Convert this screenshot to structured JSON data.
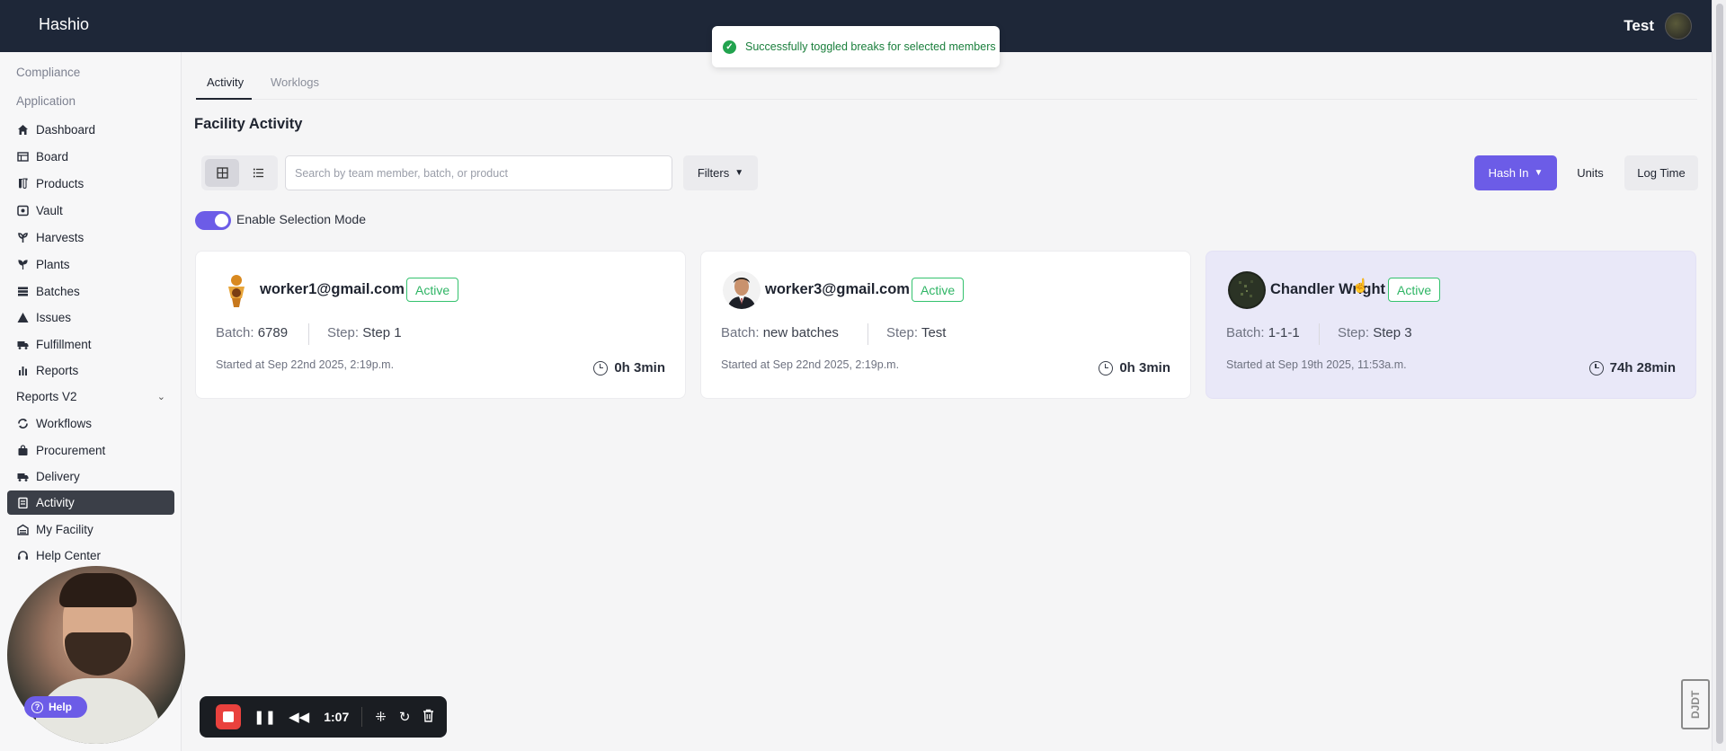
{
  "app": {
    "brand": "Hashio",
    "user_name": "Test"
  },
  "toast": {
    "message": "Successfully toggled breaks for selected members"
  },
  "sidebar": {
    "sections": [
      "Compliance",
      "Application"
    ],
    "items": [
      {
        "label": "Dashboard",
        "icon": "home-icon"
      },
      {
        "label": "Board",
        "icon": "board-icon"
      },
      {
        "label": "Products",
        "icon": "flask-icon"
      },
      {
        "label": "Vault",
        "icon": "vault-icon"
      },
      {
        "label": "Harvests",
        "icon": "sprout-icon"
      },
      {
        "label": "Plants",
        "icon": "plant-icon"
      },
      {
        "label": "Batches",
        "icon": "layers-icon"
      },
      {
        "label": "Issues",
        "icon": "warning-icon"
      },
      {
        "label": "Fulfillment",
        "icon": "truck-icon"
      },
      {
        "label": "Reports",
        "icon": "bar-chart-icon"
      },
      {
        "label": "Reports V2",
        "icon": "",
        "expandable": true
      },
      {
        "label": "Workflows",
        "icon": "workflow-icon"
      },
      {
        "label": "Procurement",
        "icon": "bag-icon"
      },
      {
        "label": "Delivery",
        "icon": "truck-icon"
      },
      {
        "label": "Activity",
        "icon": "clipboard-icon",
        "active": true
      },
      {
        "label": "My Facility",
        "icon": "building-icon"
      },
      {
        "label": "Help Center",
        "icon": "headset-icon"
      }
    ]
  },
  "tabs": [
    {
      "label": "Activity",
      "active": true
    },
    {
      "label": "Worklogs",
      "active": false
    }
  ],
  "page": {
    "title": "Facility Activity"
  },
  "toolbar": {
    "search_placeholder": "Search by team member, batch, or product",
    "filters_label": "Filters",
    "hash_in_label": "Hash In",
    "units_label": "Units",
    "log_time_label": "Log Time"
  },
  "selection_mode": {
    "label": "Enable Selection Mode",
    "enabled": true
  },
  "cards": [
    {
      "name": "worker1@gmail.com",
      "status": "Active",
      "batch_label": "Batch:",
      "batch": "6789",
      "step_label": "Step:",
      "step": "Step 1",
      "started": "Started at Sep 22nd 2025, 2:19p.m.",
      "duration": "0h 3min",
      "selected": false
    },
    {
      "name": "worker3@gmail.com",
      "status": "Active",
      "batch_label": "Batch:",
      "batch": "new batches",
      "step_label": "Step:",
      "step": "Test",
      "started": "Started at Sep 22nd 2025, 2:19p.m.",
      "duration": "0h 3min",
      "selected": false
    },
    {
      "name": "Chandler Wright",
      "status": "Active",
      "batch_label": "Batch:",
      "batch": "1-1-1",
      "step_label": "Step:",
      "step": "Step 3",
      "started": "Started at Sep 19th 2025, 11:53a.m.",
      "duration": "74h 28min",
      "selected": true
    }
  ],
  "recorder": {
    "time": "1:07",
    "help_label": "Help"
  },
  "watermark": {
    "text": "DJDT"
  },
  "colors": {
    "accent": "#6c5ce7",
    "topbar": "#1e2738",
    "active_green": "#2fb565",
    "stop_red": "#e9413d"
  }
}
